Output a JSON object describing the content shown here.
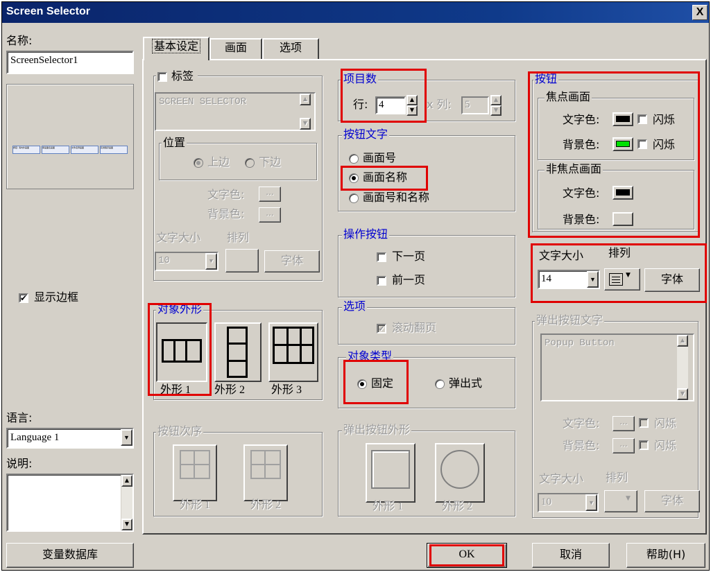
{
  "window": {
    "title": "Screen Selector",
    "close": "X"
  },
  "left": {
    "name_label": "名称:",
    "name_value": "ScreenSelector1",
    "show_border_label": "显示边框",
    "show_border_checked": true,
    "language_label": "语言:",
    "language_value": "Language 1",
    "description_label": "说明:",
    "tag_db_button": "变量数据库"
  },
  "tabs": [
    {
      "label": "基本设定",
      "active": true
    },
    {
      "label": "画面"
    },
    {
      "label": "选项"
    }
  ],
  "label_group": {
    "title": "标签",
    "text": "SCREEN SELECTOR",
    "position_title": "位置",
    "pos_top": "上边",
    "pos_bottom": "下边",
    "text_color_label": "文字色:",
    "bg_color_label": "背景色:",
    "ellipsis": "...",
    "size_label": "文字大小",
    "align_label": "排列",
    "size_value": "10",
    "font_button": "字体"
  },
  "object_shape": {
    "title": "对象外形",
    "shapes": [
      "外形 1",
      "外形 2",
      "外形 3"
    ]
  },
  "button_order": {
    "title": "按钮次序",
    "shapes": [
      "外形 1",
      "外形 2"
    ]
  },
  "item_count": {
    "title": "项目数",
    "row_label": "行:",
    "row_value": "4",
    "col_label": "x 列:",
    "col_value": "5"
  },
  "button_text": {
    "title": "按钮文字",
    "options": [
      "画面号",
      "画面名称",
      "画面号和名称"
    ],
    "selected": 1
  },
  "op_buttons": {
    "title": "操作按钮",
    "next": "下一页",
    "prev": "前一页"
  },
  "options": {
    "title": "选项",
    "scroll": "滚动翻页"
  },
  "object_type": {
    "title": "对象类型",
    "fixed": "固定",
    "popup": "弹出式",
    "selected": "fixed"
  },
  "popup_shape": {
    "title": "弹出按钮外形",
    "shapes": [
      "外形 1",
      "外形 2"
    ]
  },
  "button_group": {
    "title": "按钮",
    "focus_title": "焦点画面",
    "nonfocus_title": "非焦点画面",
    "text_color_label": "文字色:",
    "bg_color_label": "背景色:",
    "blink": "闪烁",
    "focus_text_color": "#000000",
    "focus_bg_color": "#00e000",
    "nonfocus_text_color": "#000000",
    "size_label": "文字大小",
    "align_label": "排列",
    "size_value": "14",
    "font_button": "字体"
  },
  "popup_text": {
    "title": "弹出按钮文字",
    "text": "Popup Button",
    "text_color_label": "文字色:",
    "bg_color_label": "背景色:",
    "blink": "闪烁",
    "ellipsis": "...",
    "size_label": "文字大小",
    "align_label": "排列",
    "size_value": "10",
    "font_button": "字体"
  },
  "footer": {
    "ok": "OK",
    "cancel": "取消",
    "help": "帮助(H)"
  },
  "preview_cells": [
    "按钮: 海内外画面",
    "库画面名画面",
    "文件名称画面",
    "实用程序画面"
  ]
}
